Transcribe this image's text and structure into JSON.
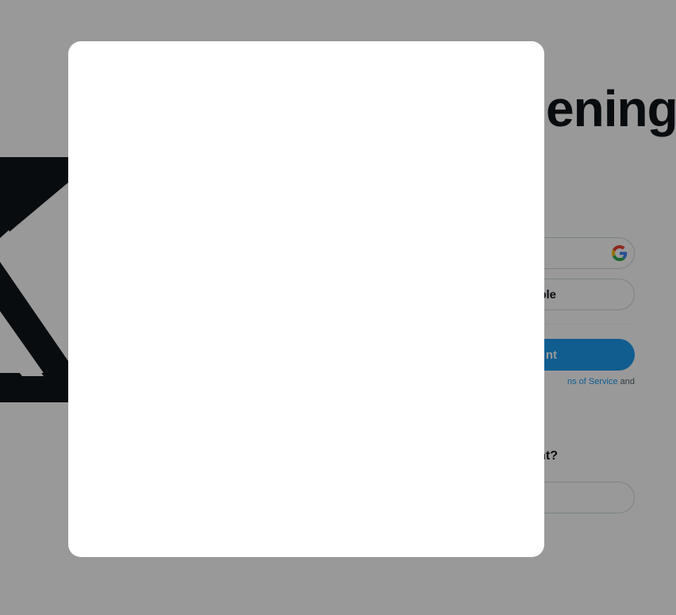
{
  "background": {
    "headline": "ening",
    "google_button_label": "",
    "apple_button_label": "Apple",
    "create_account_label": "nt",
    "terms_prefix": "",
    "terms_link": "ns of Service",
    "terms_suffix": " and",
    "have_account_label": "nt?",
    "sign_in_label": ""
  },
  "modal": {
    "content": ""
  },
  "colors": {
    "overlay": "rgba(0,0,0,0.4)",
    "accent": "#1d9bf0",
    "text": "#0f1419",
    "modal_bg": "#ffffff"
  },
  "icons": {
    "logo": "x-logo-icon",
    "google": "google-icon"
  }
}
